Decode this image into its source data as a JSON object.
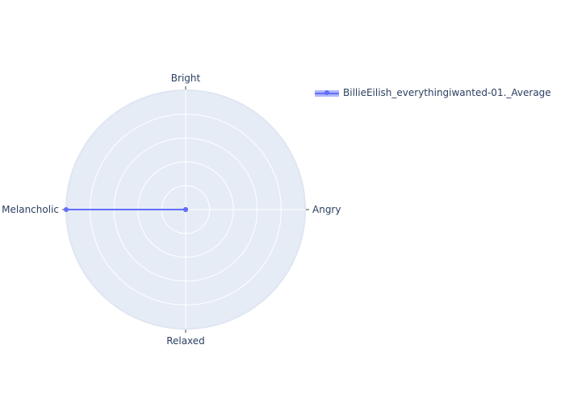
{
  "chart_data": {
    "type": "radar",
    "axes": [
      "Bright",
      "Angry",
      "Relaxed",
      "Melancholic"
    ],
    "range": [
      0,
      1
    ],
    "grid": true,
    "legend_position": "top-right",
    "colors": {
      "background": "#ffffff",
      "polar_bg": "#e5ecf6",
      "grid": "#ffffff",
      "axis_text": "#2a3f5f",
      "series": "#636efa"
    },
    "series": [
      {
        "name": "BillieEilish_everythingiwanted-01._Average",
        "values": [
          0,
          0,
          0,
          1
        ]
      }
    ]
  }
}
